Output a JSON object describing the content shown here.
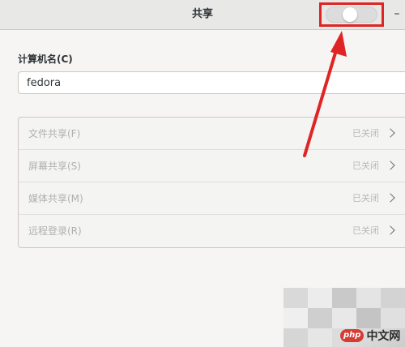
{
  "header": {
    "title": "共享",
    "minimize_label": "–",
    "sharing_toggle": {
      "on": false
    }
  },
  "computer_name": {
    "label": "计算机名(C)",
    "value": "fedora"
  },
  "sharing_items": [
    {
      "label": "文件共享(F)",
      "status": "已关闭"
    },
    {
      "label": "屏幕共享(S)",
      "status": "已关闭"
    },
    {
      "label": "媒体共享(M)",
      "status": "已关闭"
    },
    {
      "label": "远程登录(R)",
      "status": "已关闭"
    }
  ],
  "watermark": {
    "logo": "php",
    "text": "中文网"
  },
  "colors": {
    "annotation": "#e02424",
    "background": "#f6f5f4",
    "headerbar": "#e8e8e7"
  },
  "icons": [
    "chevron-right-icon",
    "minimize-icon",
    "arrow-annotation-icon"
  ]
}
